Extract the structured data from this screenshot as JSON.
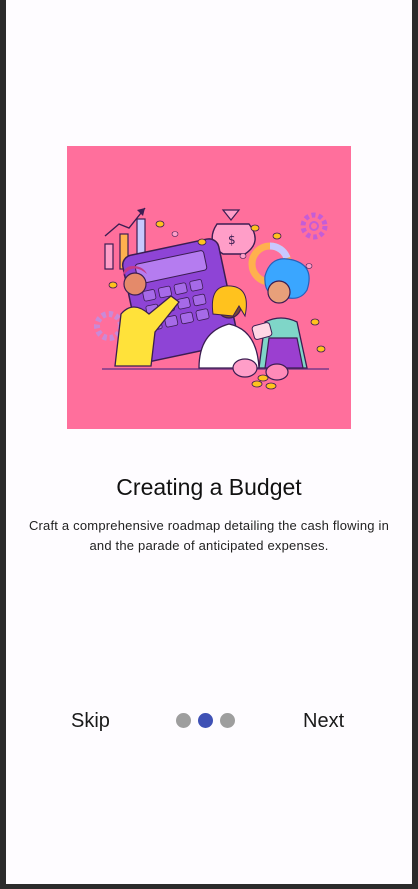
{
  "onboarding": {
    "title": "Creating a Budget",
    "description": "Craft a comprehensive roadmap detailing the cash flowing in and the parade of anticipated expenses.",
    "illustration_icon": "budget-team-illustration"
  },
  "navigation": {
    "skip_label": "Skip",
    "next_label": "Next",
    "page_indicator": {
      "total": 3,
      "current": 2
    }
  },
  "colors": {
    "illustration_bg": "#ff6f9c",
    "active_dot": "#3f51b5",
    "inactive_dot": "#9e9e9e",
    "frame": "#2b2b2b"
  }
}
